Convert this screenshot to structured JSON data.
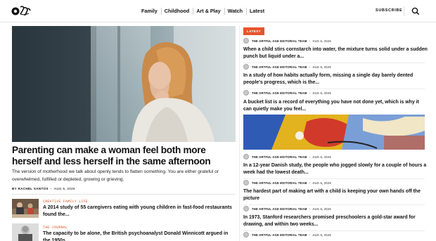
{
  "header": {
    "nav": [
      "Family",
      "Childhood",
      "Art & Play",
      "Watch",
      "Latest"
    ],
    "subscribe_label": "SUBSCRIBE"
  },
  "hero": {
    "title": "Parenting can make a woman feel both more herself and less herself in the same afternoon",
    "excerpt": "The version of motherhood we talk about openly tends to flatten something. You are either grateful or overwhelmed, fulfilled or depleted, growing or grieving.",
    "author": "BY RACHEL SANTOS",
    "date": "AUG 6, 2026"
  },
  "left_list": [
    {
      "category": "CREATIVE FAMILY LIFE",
      "title": "A 2014 study of 55 caregivers eating with young children in fast-food restaurants found the..."
    },
    {
      "category": "THE JOURNAL",
      "title": "The capacity to be alone, the British psychoanalyst Donald Winnicott argued in the 1950s..."
    }
  ],
  "latest": {
    "tag": "LATEST",
    "items": [
      {
        "author": "THE ARTFUL AGE EDITORIAL TEAM",
        "date": "AUG 6, 2026",
        "title": "When a child stirs cornstarch into water, the mixture turns solid under a sudden punch but liquid under a..."
      },
      {
        "author": "THE ARTFUL AGE EDITORIAL TEAM",
        "date": "AUG 6, 2026",
        "title": "In a study of how habits actually form, missing a single day barely dented people's progress, which is the..."
      },
      {
        "author": "THE ARTFUL AGE EDITORIAL TEAM",
        "date": "AUG 6, 2026",
        "title": "A bucket list is a record of everything you have not done yet, which is why it can quietly make you feel..."
      },
      {
        "author": "THE ARTFUL AGE EDITORIAL TEAM",
        "date": "AUG 6, 2026",
        "title": "In a 12-year Danish study, the people who jogged slowly for a couple of hours a week had the lowest death..."
      },
      {
        "author": "THE ARTFUL AGE EDITORIAL TEAM",
        "date": "AUG 6, 2026",
        "title": "The hardest part of making art with a child is keeping your own hands off the picture"
      },
      {
        "author": "THE ARTFUL AGE EDITORIAL TEAM",
        "date": "AUG 6, 2026",
        "title": "In 1973, Stanford researchers promised preschoolers a gold-star award for drawing, and within two weeks..."
      },
      {
        "author": "THE ARTFUL AGE EDITORIAL TEAM",
        "date": "AUG 5, 2026",
        "title": ""
      }
    ]
  },
  "colors": {
    "accent": "#e8542c",
    "text": "#111111",
    "rule": "#ececec"
  },
  "icons": {
    "logo": "the-artful-age-logo",
    "search": "search-icon",
    "avatar": "author-avatar"
  }
}
